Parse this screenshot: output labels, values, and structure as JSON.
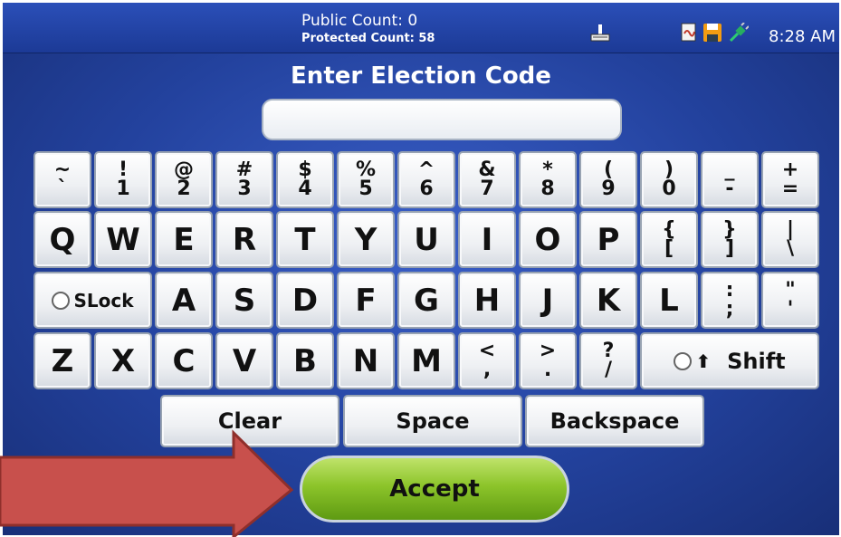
{
  "status": {
    "public_count": "Public Count: 0",
    "protected_count": "Protected Count: 58",
    "time": "8:28 AM",
    "icons": [
      "printer-icon",
      "document-icon",
      "floppy-disk-icon",
      "plug-icon"
    ]
  },
  "title": "Enter Election Code",
  "input": {
    "value": ""
  },
  "keys": {
    "row1": [
      {
        "top": "~",
        "bottom": "`"
      },
      {
        "top": "!",
        "bottom": "1"
      },
      {
        "top": "@",
        "bottom": "2"
      },
      {
        "top": "#",
        "bottom": "3"
      },
      {
        "top": "$",
        "bottom": "4"
      },
      {
        "top": "%",
        "bottom": "5"
      },
      {
        "top": "^",
        "bottom": "6"
      },
      {
        "top": "&",
        "bottom": "7"
      },
      {
        "top": "*",
        "bottom": "8"
      },
      {
        "top": "(",
        "bottom": "9"
      },
      {
        "top": ")",
        "bottom": "0"
      },
      {
        "top": "_",
        "bottom": "-"
      },
      {
        "top": "+",
        "bottom": "="
      }
    ],
    "row2": [
      "Q",
      "W",
      "E",
      "R",
      "T",
      "Y",
      "U",
      "I",
      "O",
      "P"
    ],
    "row2_stacked": [
      {
        "top": "{",
        "bottom": "["
      },
      {
        "top": "}",
        "bottom": "]"
      },
      {
        "top": "|",
        "bottom": "\\"
      }
    ],
    "slock": "SLock",
    "row3": [
      "A",
      "S",
      "D",
      "F",
      "G",
      "H",
      "J",
      "K",
      "L"
    ],
    "row3_stacked": [
      {
        "top": ":",
        "bottom": ";"
      },
      {
        "top": "\"",
        "bottom": "'"
      }
    ],
    "row4": [
      "Z",
      "X",
      "C",
      "V",
      "B",
      "N",
      "M"
    ],
    "row4_stacked": [
      {
        "top": "<",
        "bottom": ","
      },
      {
        "top": ">",
        "bottom": "."
      },
      {
        "top": "?",
        "bottom": "/"
      }
    ],
    "shift": "Shift",
    "clear": "Clear",
    "space": "Space",
    "backspace": "Backspace"
  },
  "accept": "Accept",
  "colors": {
    "screen_blue": "#23429e",
    "accept_green": "#8cc42a",
    "arrow_red": "#c8504c"
  }
}
